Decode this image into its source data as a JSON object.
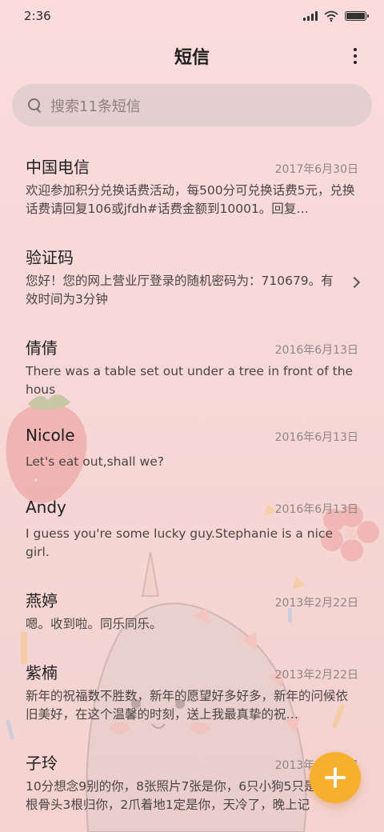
{
  "status_bar": {
    "time": "2:36",
    "battery_level": 1.0
  },
  "header": {
    "title": "短信",
    "more_icon": "more-vertical-icon"
  },
  "search": {
    "placeholder": "搜索11条短信",
    "icon": "search-icon"
  },
  "messages": [
    {
      "name": "中国电信",
      "date": "2017年6月30日",
      "preview": "欢迎参加积分兑换话费活动，每500分可兑换话费5元，兑换话费请回复106或jfdh#话费金额到10001。回复…"
    },
    {
      "name": "验证码",
      "date": "",
      "preview": "您好！您的网上营业厅登录的随机密码为：710679。有效时间为3分钟"
    },
    {
      "name": "倩倩",
      "date": "2016年6月13日",
      "preview": "There was a table set out under a tree in front of the hous"
    },
    {
      "name": "Nicole",
      "date": "2016年6月13日",
      "preview": "Let's eat out,shall we?"
    },
    {
      "name": "Andy",
      "date": "2016年6月13日",
      "preview": "I guess you're some lucky guy.Stephanie is a nice girl."
    },
    {
      "name": "燕婷",
      "date": "2013年2月22日",
      "preview": "嗯。收到啦。同乐同乐。"
    },
    {
      "name": "紫楠",
      "date": "2013年2月22日",
      "preview": "新年的祝福数不胜数，新年的愿望好多好多，新年的问候依旧美好，在这个温馨的时刻，送上我最真挚的祝…"
    },
    {
      "name": "子玲",
      "date": "2013年2月22日",
      "preview": "10分想念9别的你，8张照片7张是你，6只小狗5只是你，4根骨头3根归你，2爪着地1定是你，天冷了，晚上记"
    }
  ],
  "fab": {
    "icon": "plus-icon",
    "color": "#f6b02d"
  }
}
